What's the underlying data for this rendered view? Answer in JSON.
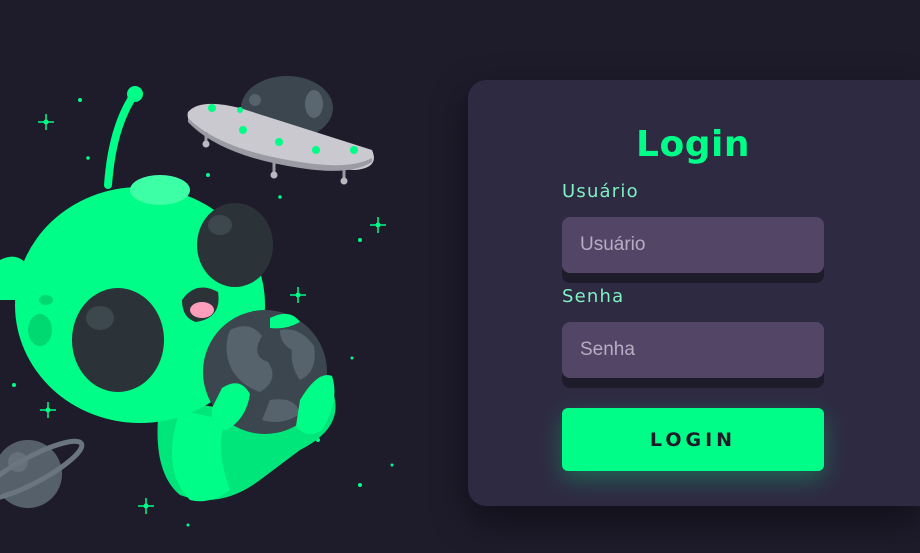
{
  "login_card": {
    "title": "Login",
    "username": {
      "label": "Usuário",
      "placeholder": "Usuário",
      "value": ""
    },
    "password": {
      "label": "Senha",
      "placeholder": "Senha",
      "value": ""
    },
    "submit_label": "LOGIN"
  },
  "illustration": {
    "subject": "alien-holding-planet",
    "elements": [
      "alien",
      "ufo",
      "earth-globe",
      "ringed-planet",
      "sparkle-stars"
    ]
  },
  "colors": {
    "background": "#1e1b2b",
    "card": "#2e2a42",
    "accent": "#00fd87",
    "label": "#7ff1c4",
    "input": "#524566"
  }
}
